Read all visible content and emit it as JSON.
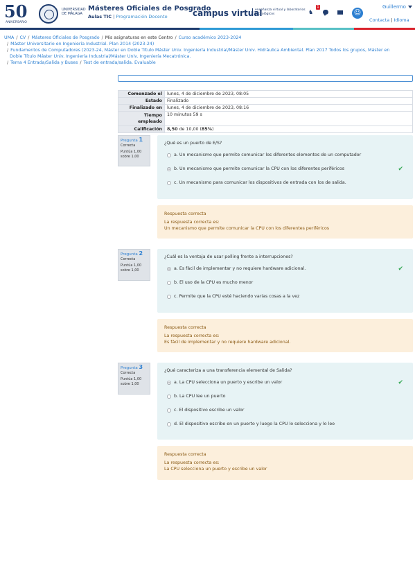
{
  "header": {
    "anniversary_number": "50",
    "anniversary_label": "ANIVERSARIO",
    "university_name": "UNIVERSIDAD DE MÁLAGA",
    "site_title": "Másteres Oficiales de Posgrado",
    "site_sub_bold": "Aulas TIC",
    "site_sub_sep": "|",
    "site_sub_link": "Programación Docente",
    "campus_logo": "campus virtual",
    "campus_tagline": "enseñanza virtual y laboratorios tecnológicos",
    "notification_count": "1",
    "user_name": "Guillermo",
    "link_contact": "Contacta",
    "link_sep": "|",
    "link_language": "Idioma",
    "colorbar": [
      "#1f3c6e",
      "#1f3c6e",
      "#2f9bd6",
      "#58c0c6",
      "#d9232d"
    ]
  },
  "breadcrumb": {
    "line1": [
      "UMA",
      "CV",
      "Másteres Oficiales de Posgrado",
      "Mis asignaturas en este Centro",
      "Curso académico 2023-2024"
    ],
    "line2": "Máster Universitario en Ingeniería Industrial. Plan 2014 (2023-24)",
    "line3a": "Fundamentos de Computadores (2023-24, Máster en Doble Título Máster Univ. Ingeniería Industrial/Máster Univ. Hidráulica Ambiental. Plan 2017 Todos los grupos, Máster en",
    "line3b": "Doble Título Máster Univ. Ingeniería Industrial/Máster Univ. Ingeniería Mecatrónica.",
    "line4a": "Tema 4 Entrada/Salida y Buses",
    "line4b": "Test de entrada/salida. Evaluable"
  },
  "summary": {
    "rows": [
      {
        "label": "Comenzado el",
        "value": "lunes, 4 de diciembre de 2023, 08:05"
      },
      {
        "label": "Estado",
        "value": "Finalizado"
      },
      {
        "label": "Finalizado en",
        "value": "lunes, 4 de diciembre de 2023, 08:16"
      },
      {
        "label": "Tiempo empleado",
        "value": "10 minutos 59 s"
      }
    ],
    "grade_label": "Calificación",
    "grade_value": "8,50",
    "grade_rest": "de 10,00 (",
    "grade_percent": "85%",
    "grade_close": ")"
  },
  "questions": [
    {
      "label": "Pregunta",
      "number": "1",
      "status": "Correcta",
      "score": "Puntúa 1,00 sobre 1,00",
      "text": "¿Qué es un puerto de E/S?",
      "answers": [
        "a. Un mecanismo que permite comunicar los diferentes elementos de un computador",
        "b. Un mecanismo que permite comunicar la CPU con los diferentes periféricos",
        "c. Un mecanismo para comunicar los dispositivos de entrada con los de salida."
      ],
      "feedback_status": "Respuesta correcta",
      "feedback_label": "La respuesta correcta es:",
      "feedback_answer": "Un mecanismo que permite comunicar la CPU con los diferentes periféricos"
    },
    {
      "label": "Pregunta",
      "number": "2",
      "status": "Correcta",
      "score": "Puntúa 1,00 sobre 1,00",
      "text": "¿Cuál es la ventaja de usar polling frente a interrupciones?",
      "answers": [
        "a. Es fácil de implementar y no requiere hardware adicional.",
        "b. El uso de la CPU es mucho menor",
        "c. Permite que la CPU esté haciendo varias cosas a la vez"
      ],
      "feedback_status": "Respuesta correcta",
      "feedback_label": "La respuesta correcta es:",
      "feedback_answer": "Es fácil de implementar y no requiere hardware adicional."
    },
    {
      "label": "Pregunta",
      "number": "3",
      "status": "Correcta",
      "score": "Puntúa 1,00 sobre 1,00",
      "text": "¿Qué caracteriza a una transferencia elemental de Salida?",
      "answers": [
        "a. La CPU selecciona un puerto y escribe un valor",
        "b. La CPU lee un puerto",
        "c. El dispositivo escribe un valor",
        "d. El dispositivo escribe en un puerto y luego la CPU lo selecciona y lo lee"
      ],
      "feedback_status": "Respuesta correcta",
      "feedback_label": "La respuesta correcta es:",
      "feedback_answer": "La CPU selecciona un puerto y escribe un valor"
    }
  ]
}
